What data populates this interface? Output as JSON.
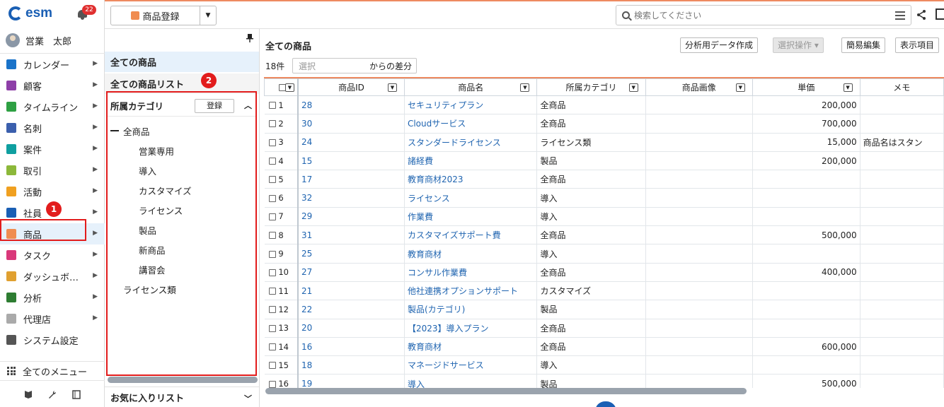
{
  "app": {
    "logo_text": "esm",
    "notification_count": "22"
  },
  "user": {
    "name": "営業　太郎"
  },
  "nav": {
    "items": [
      {
        "label": "カレンダー",
        "icon": "calendar-icon",
        "color": "#1a73c9"
      },
      {
        "label": "顧客",
        "icon": "building-icon",
        "color": "#8e3fa8"
      },
      {
        "label": "タイムライン",
        "icon": "chat-icon",
        "color": "#2ea043"
      },
      {
        "label": "名刺",
        "icon": "card-icon",
        "color": "#3b5fad"
      },
      {
        "label": "案件",
        "icon": "folder-icon",
        "color": "#0f9fa0"
      },
      {
        "label": "取引",
        "icon": "deal-icon",
        "color": "#8cb83a"
      },
      {
        "label": "活動",
        "icon": "clipboard-icon",
        "color": "#f0a020"
      },
      {
        "label": "社員",
        "icon": "person-icon",
        "color": "#1a5fb4"
      },
      {
        "label": "商品",
        "icon": "box-icon",
        "color": "#f08c50",
        "active": true
      },
      {
        "label": "タスク",
        "icon": "task-icon",
        "color": "#d9387a"
      },
      {
        "label": "ダッシュボ…",
        "icon": "dashboard-icon",
        "color": "#e0a030"
      },
      {
        "label": "分析",
        "icon": "chart-icon",
        "color": "#2e7d32"
      },
      {
        "label": "代理店",
        "icon": "doc-icon",
        "color": "#aaaaaa"
      },
      {
        "label": "システム設定",
        "icon": "gear-icon",
        "color": "#555555"
      }
    ],
    "all_menu": "全てのメニュー"
  },
  "annotations": {
    "badge1": "1",
    "badge2": "2"
  },
  "toolbar": {
    "register_label": "商品登録",
    "search_placeholder": "検索してください"
  },
  "panel": {
    "all_products": "全ての商品",
    "all_products_list": "全ての商品リスト",
    "category_title": "所属カテゴリ",
    "category_register": "登録",
    "tree": [
      {
        "label": "全商品",
        "level": 0
      },
      {
        "label": "営業専用",
        "level": 1
      },
      {
        "label": "導入",
        "level": 1
      },
      {
        "label": "カスタマイズ",
        "level": 1
      },
      {
        "label": "ライセンス",
        "level": 1
      },
      {
        "label": "製品",
        "level": 1
      },
      {
        "label": "新商品",
        "level": 1
      },
      {
        "label": "講習会",
        "level": 1
      },
      {
        "label": "ライセンス類",
        "level": 2
      }
    ],
    "favorites": "お気に入りリスト"
  },
  "content": {
    "title": "全ての商品",
    "buttons": {
      "analysis": "分析用データ作成",
      "selection": "選択操作 ▾",
      "quick_edit": "簡易編集",
      "display_items": "表示項目"
    },
    "count": "18件",
    "diff_placeholder": "選択",
    "diff_suffix": "からの差分"
  },
  "table": {
    "columns": [
      "商品ID",
      "商品名",
      "所属カテゴリ",
      "商品画像",
      "単価",
      "メモ"
    ],
    "rows": [
      {
        "n": "1",
        "id": "28",
        "name": "セキュリティプラン",
        "cat": "全商品",
        "img": "",
        "price": "200,000",
        "memo": ""
      },
      {
        "n": "2",
        "id": "30",
        "name": "Cloudサービス",
        "cat": "全商品",
        "img": "",
        "price": "700,000",
        "memo": ""
      },
      {
        "n": "3",
        "id": "24",
        "name": "スタンダードライセンス",
        "cat": "ライセンス類",
        "img": "",
        "price": "15,000",
        "memo": "商品名はスタン"
      },
      {
        "n": "4",
        "id": "15",
        "name": "諸経費",
        "cat": "製品",
        "img": "",
        "price": "200,000",
        "memo": ""
      },
      {
        "n": "5",
        "id": "17",
        "name": "教育商材2023",
        "cat": "全商品",
        "img": "",
        "price": "",
        "memo": ""
      },
      {
        "n": "6",
        "id": "32",
        "name": "ライセンス",
        "cat": "導入",
        "img": "",
        "price": "",
        "memo": ""
      },
      {
        "n": "7",
        "id": "29",
        "name": "作業費",
        "cat": "導入",
        "img": "",
        "price": "",
        "memo": ""
      },
      {
        "n": "8",
        "id": "31",
        "name": "カスタマイズサポート費",
        "cat": "全商品",
        "img": "",
        "price": "500,000",
        "memo": ""
      },
      {
        "n": "9",
        "id": "25",
        "name": "教育商材",
        "cat": "導入",
        "img": "",
        "price": "",
        "memo": ""
      },
      {
        "n": "10",
        "id": "27",
        "name": "コンサル作業費",
        "cat": "全商品",
        "img": "",
        "price": "400,000",
        "memo": ""
      },
      {
        "n": "11",
        "id": "21",
        "name": "他社連携オプションサポート",
        "cat": "カスタマイズ",
        "img": "",
        "price": "",
        "memo": ""
      },
      {
        "n": "12",
        "id": "22",
        "name": "製品(カテゴリ)",
        "cat": "製品",
        "img": "",
        "price": "",
        "memo": ""
      },
      {
        "n": "13",
        "id": "20",
        "name": "【2023】導入プラン",
        "cat": "全商品",
        "img": "",
        "price": "",
        "memo": ""
      },
      {
        "n": "14",
        "id": "16",
        "name": "教育商材",
        "cat": "全商品",
        "img": "",
        "price": "600,000",
        "memo": ""
      },
      {
        "n": "15",
        "id": "18",
        "name": "マネージドサービス",
        "cat": "導入",
        "img": "",
        "price": "",
        "memo": ""
      },
      {
        "n": "16",
        "id": "19",
        "name": "導入",
        "cat": "製品",
        "img": "",
        "price": "500,000",
        "memo": ""
      }
    ]
  }
}
